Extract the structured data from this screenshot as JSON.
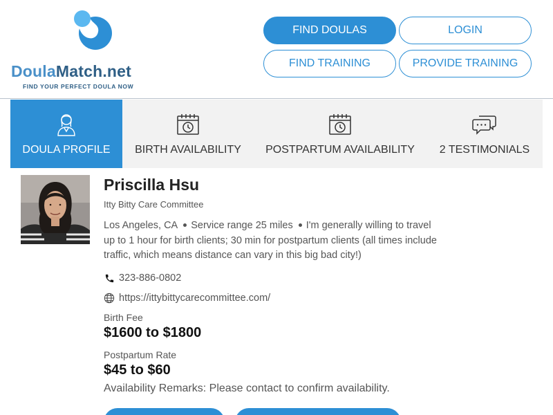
{
  "brand": {
    "name_part1": "Doula",
    "name_part2": "Match.net",
    "tagline": "FIND YOUR PERFECT DOULA NOW",
    "colors": {
      "light": "#5bb8f0",
      "mid": "#2d8fd5",
      "dark": "#2f5f86"
    }
  },
  "nav": {
    "find_doulas": "FIND DOULAS",
    "login": "LOGIN",
    "find_training": "FIND TRAINING",
    "provide_training": "PROVIDE TRAINING"
  },
  "tabs": [
    {
      "label": "DOULA PROFILE",
      "icon": "person-icon",
      "active": true
    },
    {
      "label": "BIRTH AVAILABILITY",
      "icon": "calendar-clock-icon",
      "active": false
    },
    {
      "label": "POSTPARTUM AVAILABILITY",
      "icon": "calendar-clock-icon",
      "active": false
    },
    {
      "label": "2 TESTIMONIALS",
      "icon": "chat-bubbles-icon",
      "active": false
    }
  ],
  "profile": {
    "name": "Priscilla Hsu",
    "organization": "Itty Bitty Care Committee",
    "location": "Los Angeles, CA",
    "service_range": "Service range 25 miles",
    "travel_note_start": "I'm generally willing to",
    "travel_note_rest": "travel up to 1 hour for birth clients; 30 min for postpartum clients (all times include traffic, which means distance can vary in this big bad city!)",
    "phone": "323-886-0802",
    "website": "https://ittybittycarecommittee.com/",
    "birth_fee_label": "Birth Fee",
    "birth_fee": "$1600 to $1800",
    "postpartum_rate_label": "Postpartum Rate",
    "postpartum_rate": "$45 to $60",
    "availability_remarks": "Availability Remarks: Please contact to confirm availability."
  },
  "accent_color": "#2d8fd5"
}
